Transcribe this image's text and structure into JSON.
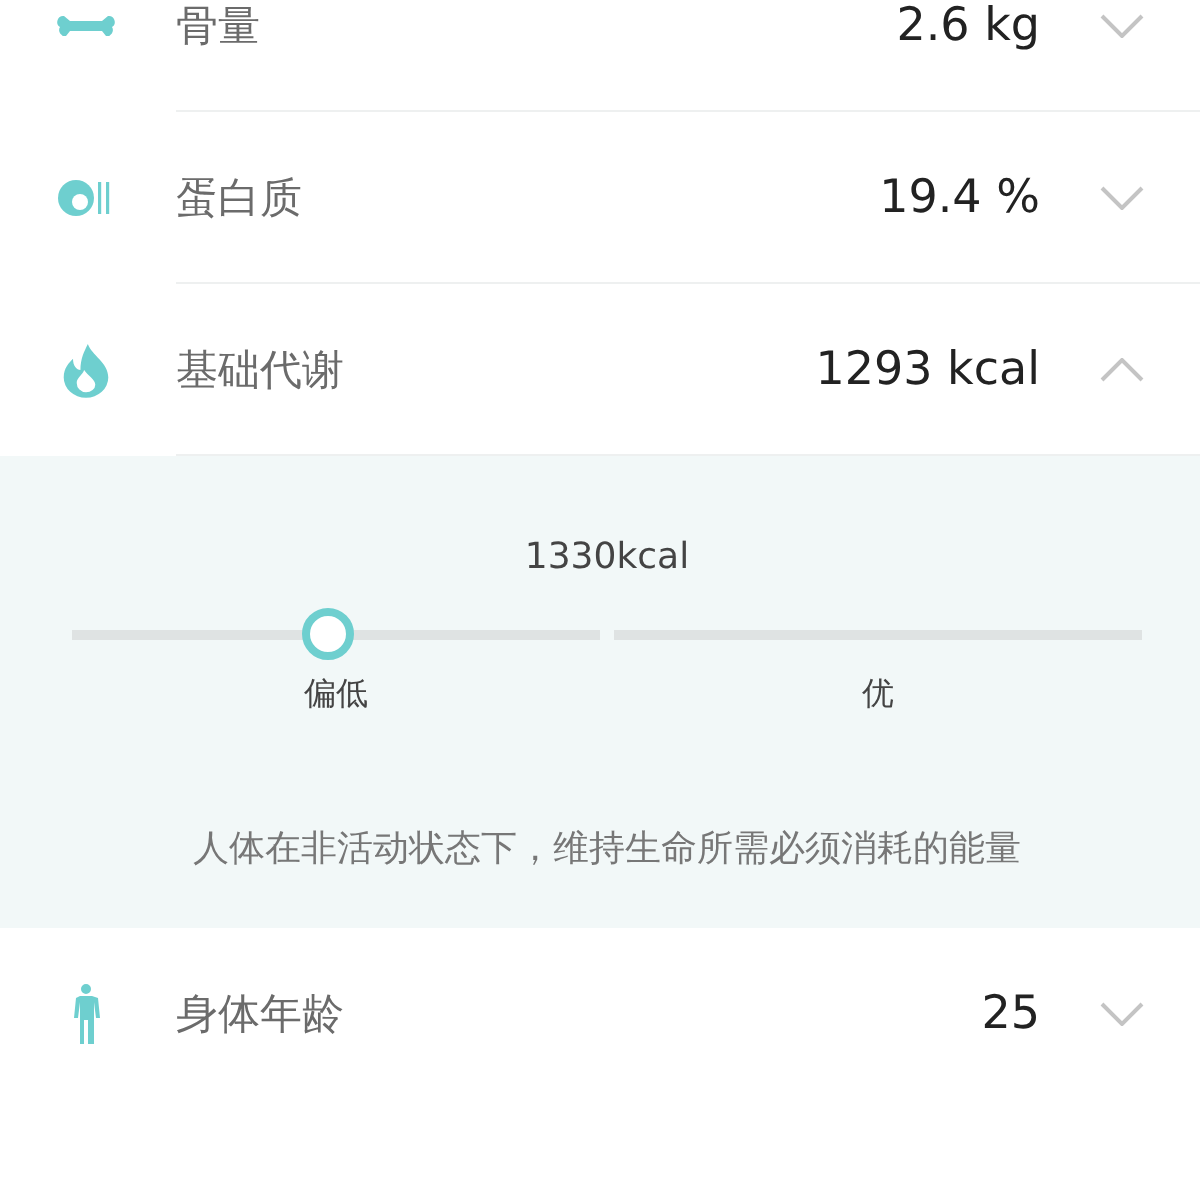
{
  "metrics": [
    {
      "label": "骨量",
      "value": "2.6 kg",
      "expanded": false
    },
    {
      "label": "蛋白质",
      "value": "19.4 %",
      "expanded": false
    },
    {
      "label": "基础代谢",
      "value": "1293 kcal",
      "expanded": true,
      "detail": {
        "reading": "1330kcal",
        "level": 0.24,
        "segments": [
          "偏低",
          "优"
        ],
        "description": "人体在非活动状态下，维持生命所需必须消耗的能量"
      }
    },
    {
      "label": "身体年龄",
      "value": "25",
      "expanded": false
    }
  ]
}
